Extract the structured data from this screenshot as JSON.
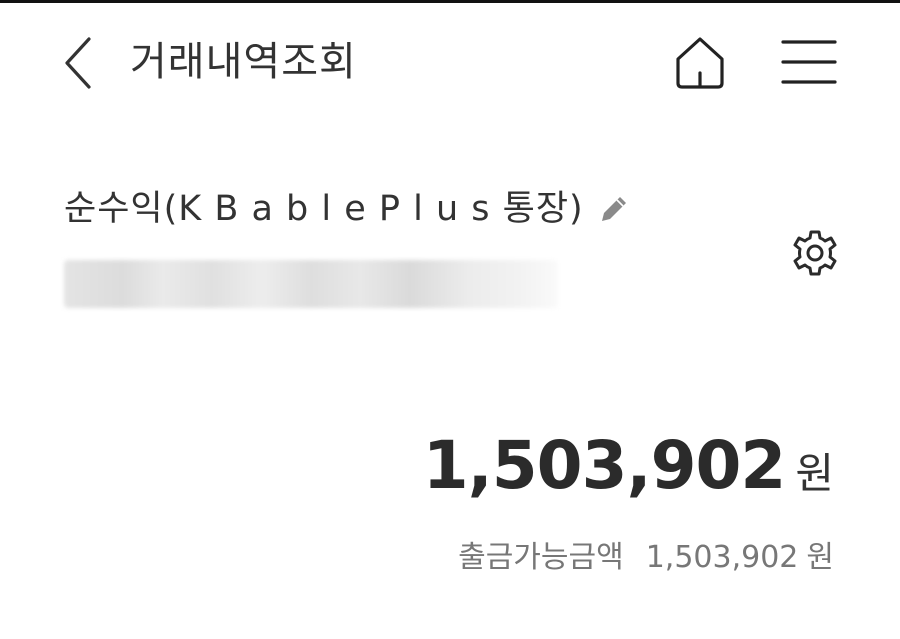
{
  "header": {
    "title": "거래내역조회",
    "back_icon": "chevron-left-icon",
    "home_icon": "home-icon",
    "menu_icon": "hamburger-menu-icon"
  },
  "account": {
    "name": "순수익(K B  a b l e  P l u s 통장)",
    "edit_icon": "pencil-icon",
    "settings_icon": "gear-icon"
  },
  "balance": {
    "amount": "1,503,902",
    "unit": "원"
  },
  "available": {
    "label": "출금가능금액",
    "amount": "1,503,902",
    "unit": "원"
  },
  "colors": {
    "text_primary": "#2b2b2b",
    "text_secondary": "#777777",
    "icon_gray": "#888888",
    "background": "#ffffff"
  }
}
